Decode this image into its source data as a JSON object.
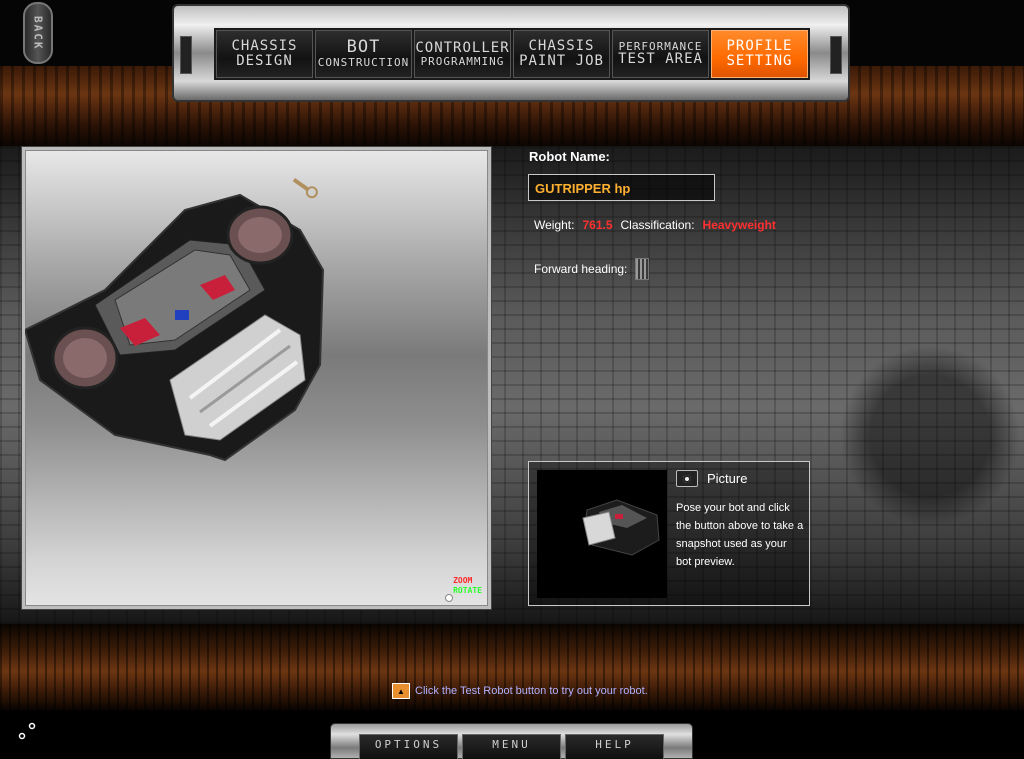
{
  "back_button": {
    "label": "BACK"
  },
  "nav": {
    "tabs": [
      {
        "line1": "CHASSIS",
        "line2": "DESIGN",
        "active": false
      },
      {
        "line1": "BOT",
        "line2": "CONSTRUCTION",
        "active": false
      },
      {
        "line1": "CONTROLLER",
        "line2": "PROGRAMMING",
        "active": false
      },
      {
        "line1": "CHASSIS",
        "line2": "PAINT JOB",
        "active": false
      },
      {
        "line1": "PERFORMANCE",
        "line2": "TEST AREA",
        "active": false
      },
      {
        "line1": "PROFILE",
        "line2": "SETTING",
        "active": true
      }
    ]
  },
  "viewport": {
    "zoom_label": "ZOOM",
    "rotate_label": "ROTATE"
  },
  "profile": {
    "robot_name_label": "Robot Name:",
    "robot_name_value": "GUTRIPPER hp",
    "weight_label": "Weight:",
    "weight_value": "761.5",
    "classification_label": "Classification:",
    "classification_value": "Heavyweight",
    "forward_heading_label": "Forward heading:"
  },
  "picture": {
    "title": "Picture",
    "description": "Pose your bot and click the button above to take a snapshot used as your bot preview."
  },
  "hint": {
    "text": "Click the Test Robot button to try out your robot."
  },
  "bottom_menu": {
    "options_label": "OPTIONS",
    "menu_label": "MENU",
    "help_label": "HELP"
  },
  "colors": {
    "accent_orange": "#ff6a00",
    "robot_name_color": "#ffb030",
    "value_red": "#ff3030",
    "hint_blue": "#b0b0ff"
  }
}
